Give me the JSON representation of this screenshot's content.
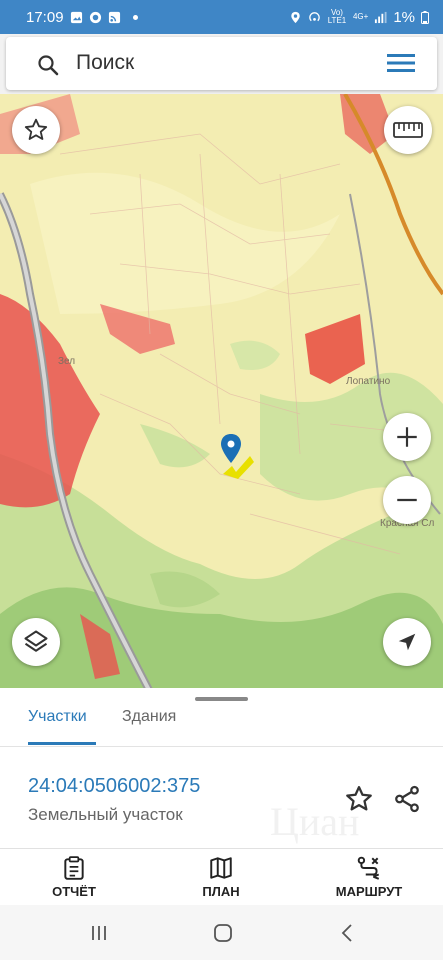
{
  "status_bar": {
    "time": "17:09",
    "network": "Vo) LTE1",
    "network_type": "4G+",
    "battery": "1%",
    "color": "#3f86c6"
  },
  "search": {
    "placeholder": "Поиск"
  },
  "map": {
    "labels": {
      "village_west": "Зел",
      "village_east": "Лопатино",
      "village_southeast": "Красная Сл"
    },
    "marker_color": "#1b6fb5",
    "parcel_color": "#e8e000"
  },
  "sheet": {
    "tabs": [
      {
        "label": "Участки",
        "active": true
      },
      {
        "label": "Здания",
        "active": false
      }
    ],
    "parcel": {
      "number": "24:04:0506002:375",
      "type": "Земельный участок"
    },
    "watermark": "Циан",
    "accent": "#2b7ab8"
  },
  "bottom_nav": {
    "items": [
      {
        "label": "ОТЧЁТ",
        "icon": "clipboard-icon"
      },
      {
        "label": "ПЛАН",
        "icon": "map-book-icon"
      },
      {
        "label": "МАРШРУТ",
        "icon": "route-icon"
      }
    ]
  },
  "system_nav": {
    "buttons": [
      "recent-apps-icon",
      "home-icon",
      "back-icon"
    ]
  }
}
